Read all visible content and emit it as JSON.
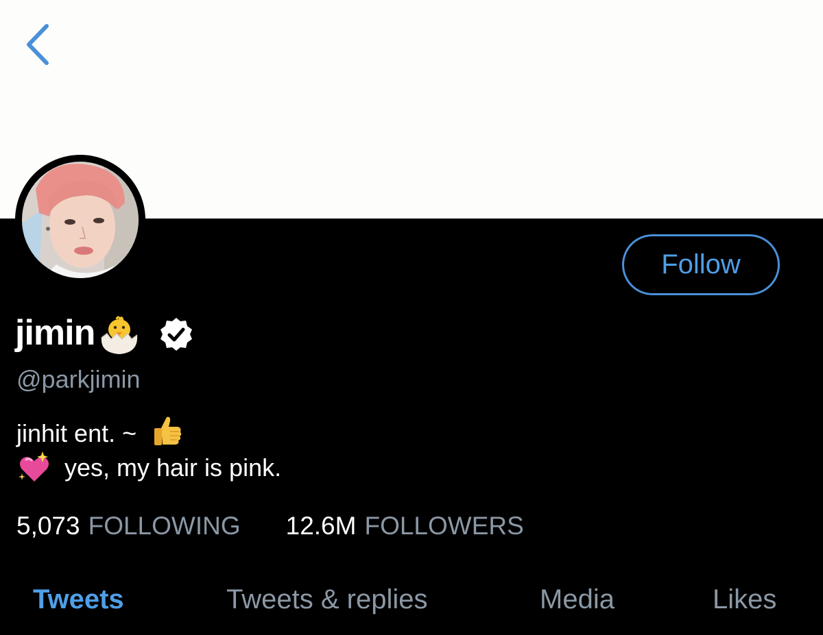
{
  "header": {
    "back_icon": "chevron-left-icon"
  },
  "profile": {
    "avatar_alt": "profile photo",
    "display_name": "jimin",
    "name_emoji": "hatching-chick-icon",
    "verified_icon": "verified-badge-icon",
    "handle": "@parkjimin",
    "follow_label": "Follow"
  },
  "bio": {
    "line1_text": "jinhit ent. ~",
    "line1_emoji": "thumbs-up-icon",
    "line2_emoji": "sparkling-heart-icon",
    "line2_text": "yes, my hair is pink."
  },
  "stats": {
    "following_count": "5,073",
    "following_label": "FOLLOWING",
    "followers_count": "12.6M",
    "followers_label": "FOLLOWERS"
  },
  "tabs": [
    {
      "label": "Tweets",
      "active": true
    },
    {
      "label": "Tweets & replies",
      "active": false
    },
    {
      "label": "Media",
      "active": false
    },
    {
      "label": "Likes",
      "active": false
    }
  ],
  "colors": {
    "accent": "#4f9ee6",
    "background": "#000000",
    "banner": "#fdfdfb",
    "muted_text": "#8b98a5"
  }
}
